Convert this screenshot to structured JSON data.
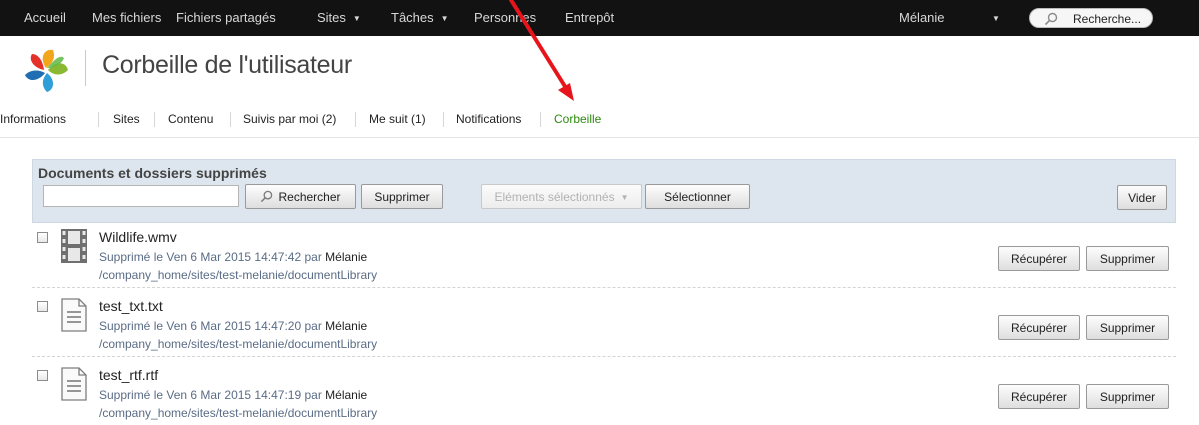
{
  "topnav": {
    "items": [
      "Accueil",
      "Mes fichiers",
      "Fichiers partagés",
      "Sites",
      "Tâches",
      "Personnes",
      "Entrepôt"
    ],
    "dropdown_caret": "▼",
    "user": "Mélanie",
    "search_placeholder": "Recherche..."
  },
  "header": {
    "title": "Corbeille de l'utilisateur"
  },
  "tabs": [
    "Informations",
    "Sites",
    "Contenu",
    "Suivis par moi (2)",
    "Me suit (1)",
    "Notifications",
    "Corbeille"
  ],
  "active_tab": "Corbeille",
  "trash": {
    "title": "Documents et dossiers supprimés",
    "search_value": "",
    "search_button": "Rechercher",
    "delete_button": "Supprimer",
    "selected_items_button": "Eléments sélectionnés",
    "select_button": "Sélectionner",
    "empty_button": "Vider"
  },
  "items": [
    {
      "name": "Wildlife.wmv",
      "icon": "video-file-icon",
      "deleted_text": "Supprimé le Ven 6 Mar 2015 14:47:42 par",
      "user": "Mélanie",
      "path": "/company_home/sites/test-melanie/documentLibrary"
    },
    {
      "name": "test_txt.txt",
      "icon": "text-file-icon",
      "deleted_text": "Supprimé le Ven 6 Mar 2015 14:47:20 par",
      "user": "Mélanie",
      "path": "/company_home/sites/test-melanie/documentLibrary"
    },
    {
      "name": "test_rtf.rtf",
      "icon": "text-file-icon",
      "deleted_text": "Supprimé le Ven 6 Mar 2015 14:47:19 par",
      "user": "Mélanie",
      "path": "/company_home/sites/test-melanie/documentLibrary"
    }
  ],
  "row_actions": {
    "recover": "Récupérer",
    "delete": "Supprimer"
  },
  "colors": {
    "topbar_bg": "#121212",
    "active_tab": "#2e8b0f",
    "annotation_arrow": "#e8141b",
    "panel_header_bg": "#dde6ee"
  }
}
